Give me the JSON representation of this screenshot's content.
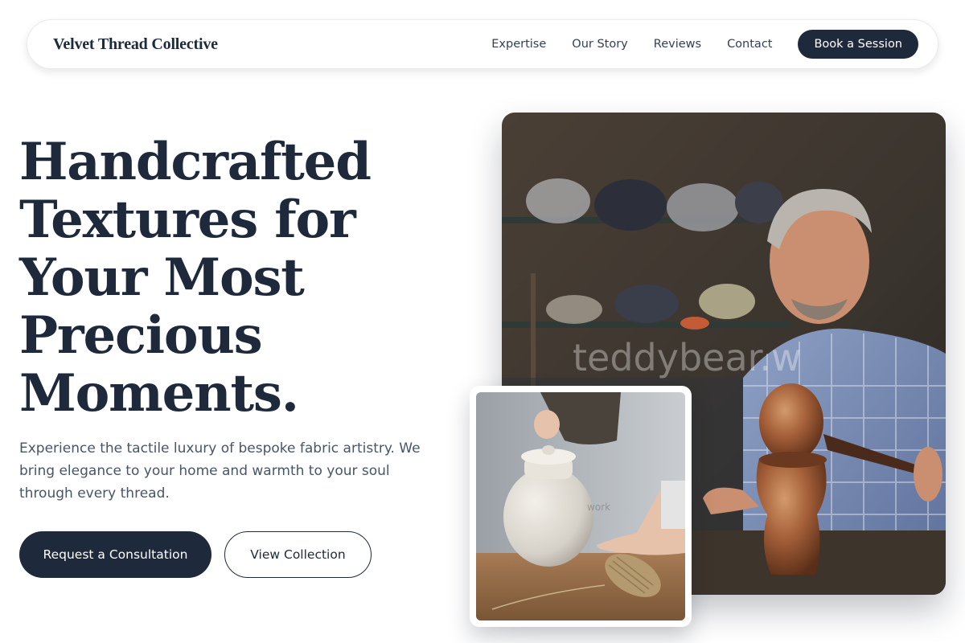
{
  "nav": {
    "brand": "Velvet Thread Collective",
    "links": [
      {
        "label": "Expertise"
      },
      {
        "label": "Our Story"
      },
      {
        "label": "Reviews"
      },
      {
        "label": "Contact"
      }
    ],
    "cta_label": "Book a Session"
  },
  "hero": {
    "headline_lines": [
      "Handcrafted",
      "Textures for",
      "Your Most",
      "Precious",
      "Moments."
    ],
    "subtext": "Experience the tactile luxury of bespoke fabric artistry. We bring elegance to your home and warmth to your soul through every thread.",
    "primary_button": "Request a Consultation",
    "secondary_button": "View Collection"
  },
  "images": {
    "main_watermark": "teddybear.w",
    "inset_watermark": "work"
  },
  "colors": {
    "primary": "#1e293b",
    "text_muted": "#475569",
    "background": "#ffffff"
  }
}
